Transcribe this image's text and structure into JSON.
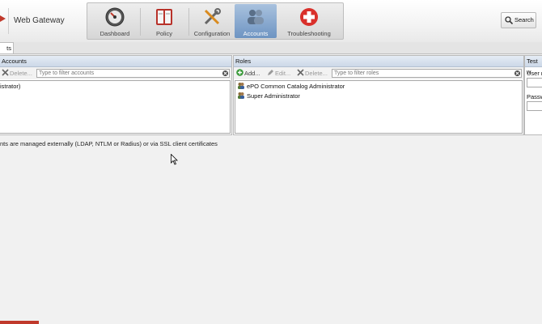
{
  "app": {
    "title": "Web Gateway"
  },
  "nav": {
    "items": [
      {
        "label": "Dashboard",
        "icon": "dashboard-gauge-icon"
      },
      {
        "label": "Policy",
        "icon": "policy-book-icon"
      },
      {
        "label": "Configuration",
        "icon": "configuration-tools-icon"
      },
      {
        "label": "Accounts",
        "icon": "accounts-users-icon",
        "active": true
      },
      {
        "label": "Troubleshooting",
        "icon": "troubleshooting-cross-icon"
      }
    ]
  },
  "search": {
    "label": "Search"
  },
  "tabs": [
    {
      "label": "ts"
    }
  ],
  "accounts_panel": {
    "title": "Accounts",
    "delete_label": "Delete...",
    "filter_placeholder": "Type to filter accounts",
    "rows": [
      "istrator)"
    ]
  },
  "roles_panel": {
    "title": "Roles",
    "add_label": "Add...",
    "edit_label": "Edit...",
    "delete_label": "Delete...",
    "filter_placeholder": "Type to filter roles",
    "rows": [
      "ePO Common Catalog Administrator",
      "Super Administrator"
    ]
  },
  "test_panel": {
    "title": "Test w",
    "user_label": "User n",
    "password_label": "Passw"
  },
  "footer_note": "nts are managed externally (LDAP, NTLM or Radius) or via SSL client certificates",
  "colors": {
    "accent": "#6e94c2",
    "header_blue": "#ccd8e8",
    "brand_red": "#c0392b"
  }
}
